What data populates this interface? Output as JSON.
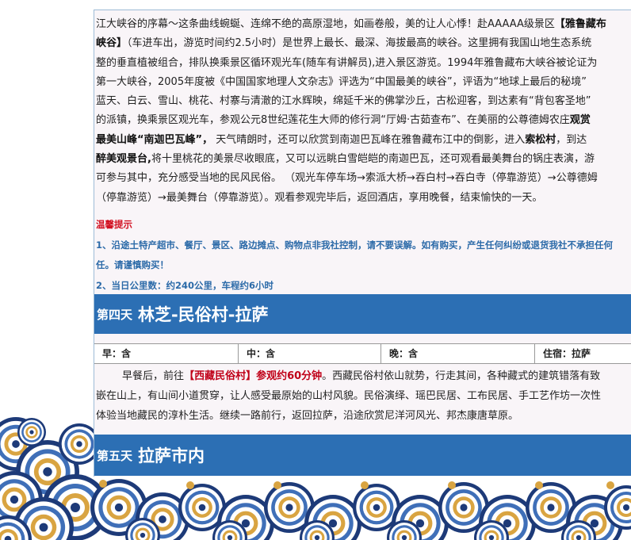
{
  "intro": {
    "l1": "江大峡谷的序幕～这条曲线蜿蜒、连绵不绝的高原湿地，如画卷般，美的让人心悸！赴AAAAA级景区",
    "l1b": "【雅鲁藏布",
    "l2b": "峡谷】",
    "l2": "（车进车出，游览时间约2.5小时）是世界上最长、最深、海拔最高的峡谷。这里拥有我国山地生态系统",
    "l3": "整的垂直植被组合，排队换乘景区循环观光车(随车有讲解员),进入景区游览。1994年雅鲁藏布大峡谷被论证为",
    "l4": "第一大峡谷，2005年度被《中国国家地理人文杂志》评选为“中国最美的峡谷”，评语为“地球上最后的秘境”",
    "l5": "蓝天、白云、雪山、桃花、村寨与清澈的江水辉映，绵延千米的佛掌沙丘，古松迎客，到达素有“背包客圣地”",
    "l6": "的派镇，换乘景区观光车，参观公元8世纪莲花生大师的修行洞“厅姆·古茹查布”、在美丽的公尊德姆农庄",
    "l6b": "观赏",
    "l7b": "最美山峰“南迦巴瓦峰”，",
    "l7": " 天气晴朗时，还可以欣赏到南迦巴瓦峰在雅鲁藏布江中的倒影，进入",
    "l7c": "索松村",
    "l7d": "，到达",
    "l8b": "醉美观景台,",
    "l8": "将十里桃花的美景尽收眼底，又可以远眺白雪皑皑的南迦巴瓦，还可观看最美舞台的锅庄表演，游",
    "l9": "可参与其中，充分感受当地的民风民俗。 （观光车停车场→索派大桥→吞白村→吞白寺（停靠游览）→公尊德姆",
    "l10": "（停靠游览）→最美舞台（停靠游览）。观看参观完毕后，返回酒店，享用晚餐，结束愉快的一天。"
  },
  "tips": {
    "title": "温馨提示",
    "item1": "1、沿途土特产超市、餐厅、景区、路边摊点、购物点非我社控制，请不要误解。如有购买，产生任何纠纷或退货我社不承担任何",
    "item1b": "任。请谨慎购买！",
    "item2": "2、当日公里数：约240公里，车程约6小时"
  },
  "day4": {
    "num": "第四天",
    "title": "林芝-民俗村-拉萨",
    "meals": {
      "breakfast": "早：含",
      "lunch": "中：含",
      "dinner": "晚：含",
      "lodging": "住宿：拉萨"
    },
    "t1a": "        早餐后，前往",
    "t1red": "【西藏民俗村】参观约60分钟",
    "t1b": "。西藏民俗村依山就势，行走其间，各种藏式的建筑错落有致",
    "t2": "嵌在山上，有山间小道贯穿，让人感受最原始的山村风貌。民俗演绎、瑶巴民居、工布民居、手工艺作坊一次性",
    "t3": "体验当地藏民的淳朴生活。继续一路前行，返回拉萨，沿途欣赏尼洋河风光、邦杰康唐草原。"
  },
  "day5": {
    "num": "第五天",
    "title": "拉萨市内"
  },
  "colors": {
    "header_blue": "#2c6fb4",
    "tip_blue": "#2b6aa8",
    "highlight_red": "#c00018",
    "deco_navy": "#1d3a78"
  }
}
